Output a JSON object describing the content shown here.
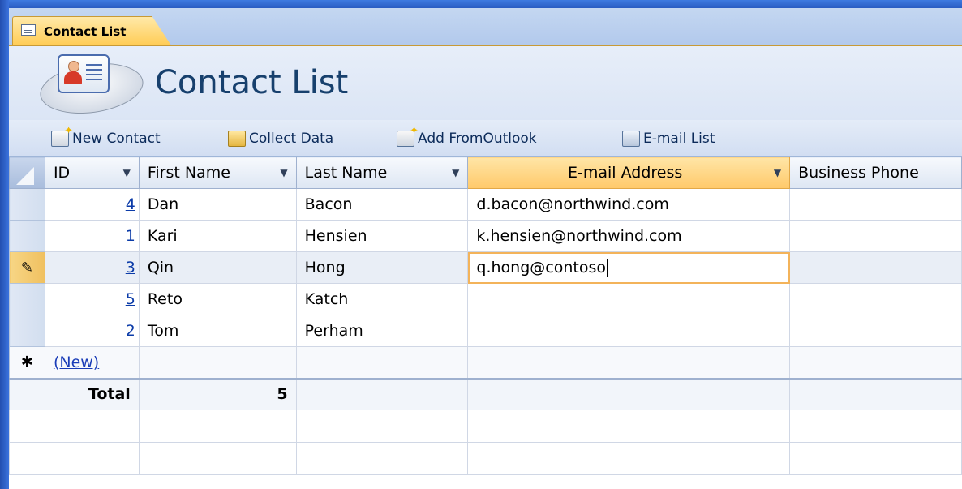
{
  "tab": {
    "label": "Contact List"
  },
  "header": {
    "title": "Contact List"
  },
  "toolbar": {
    "new_contact": {
      "pre": "",
      "hot": "N",
      "post": "ew Contact"
    },
    "collect_data": {
      "pre": "Co",
      "hot": "l",
      "post": "lect Data"
    },
    "add_outlook": {
      "pre": "Add From ",
      "hot": "O",
      "post": "utlook"
    },
    "email_list": {
      "pre": "",
      "hot": "",
      "post": "E-mail List"
    }
  },
  "grid": {
    "columns": [
      "ID",
      "First Name",
      "Last Name",
      "E-mail Address",
      "Business Phone"
    ],
    "rows": [
      {
        "id": "4",
        "first": "Dan",
        "last": "Bacon",
        "email": "d.bacon@northwind.com",
        "phone": ""
      },
      {
        "id": "1",
        "first": "Kari",
        "last": "Hensien",
        "email": "k.hensien@northwind.com",
        "phone": ""
      },
      {
        "id": "3",
        "first": "Qin",
        "last": "Hong",
        "email": "q.hong@contoso",
        "phone": ""
      },
      {
        "id": "5",
        "first": "Reto",
        "last": "Katch",
        "email": "",
        "phone": ""
      },
      {
        "id": "2",
        "first": "Tom",
        "last": "Perham",
        "email": "",
        "phone": ""
      }
    ],
    "new_row_label": "(New)",
    "new_row_marker": "✱",
    "edit_marker": "✎",
    "total_label": "Total",
    "total_value": "5"
  },
  "colors": {
    "accent": "#ffc96a",
    "frame": "#2c62c8",
    "title": "#17406d"
  },
  "icons": {
    "tab": "datasheet-icon",
    "logo": "contact-card-icon",
    "new": "new-contact-icon",
    "collect": "collect-data-icon",
    "outlook": "add-from-outlook-icon",
    "email": "email-list-icon"
  }
}
